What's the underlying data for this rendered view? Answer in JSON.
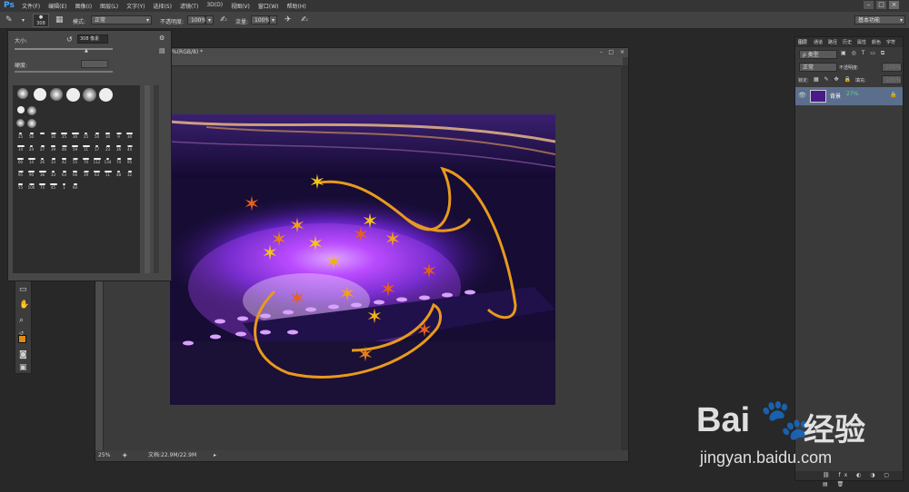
{
  "app": {
    "logo": "Ps"
  },
  "menubar": {
    "items": [
      "文件(F)",
      "编辑(E)",
      "图像(I)",
      "图层(L)",
      "文字(Y)",
      "选择(S)",
      "滤镜(T)",
      "3D(D)",
      "视图(V)",
      "窗口(W)",
      "帮助(H)"
    ]
  },
  "options": {
    "brush_size": "308",
    "mode_label": "模式:",
    "mode_value": "正常",
    "opacity_label": "不透明度:",
    "opacity_value": "100%",
    "flow_label": "流量:",
    "flow_value": "100%",
    "workspace": "基本功能"
  },
  "brush_panel": {
    "size_label": "大小:",
    "size_value": "308 像素",
    "hardness_label": "硬度:",
    "tip_numbers": [
      "25",
      "50",
      "",
      "30",
      "25",
      "30",
      "25",
      "50",
      "30",
      "9",
      "30",
      "14",
      "24",
      "27",
      "39",
      "46",
      "59",
      "11",
      "17",
      "23",
      "36",
      "44",
      "60",
      "14",
      "26",
      "33",
      "42",
      "55",
      "70",
      "112",
      "134",
      "74",
      "95",
      "95",
      "90",
      "36",
      "33",
      "63",
      "66",
      "39",
      "63",
      "11",
      "48",
      "32",
      "55",
      "100",
      "75",
      "45",
      "1",
      "60"
    ]
  },
  "document": {
    "title": "%(RGB/8) *",
    "zoom": "25%",
    "doc_info": "文档:22.9M/22.9M"
  },
  "right_panel": {
    "tabs": [
      "图层",
      "通道",
      "路径",
      "历史",
      "属性",
      "颜色",
      "字符"
    ],
    "filter_label": "ρ 类型",
    "blend_mode": "正常",
    "opacity_label": "不透明度:",
    "opacity_value": "100%",
    "lock_label": "锁定:",
    "fill_label": "填充:",
    "fill_value": "100%",
    "layer_name": "背景",
    "layer_badge": "27%"
  },
  "watermark": {
    "brand_prefix": "Bai",
    "brand_suffix": "经验",
    "url": "jingyan.baidu.com"
  },
  "colors": {
    "accent_blue": "#4aa3ff",
    "foreground_swatch": "#e08a16",
    "stroke_orange": "#e89a1c"
  }
}
